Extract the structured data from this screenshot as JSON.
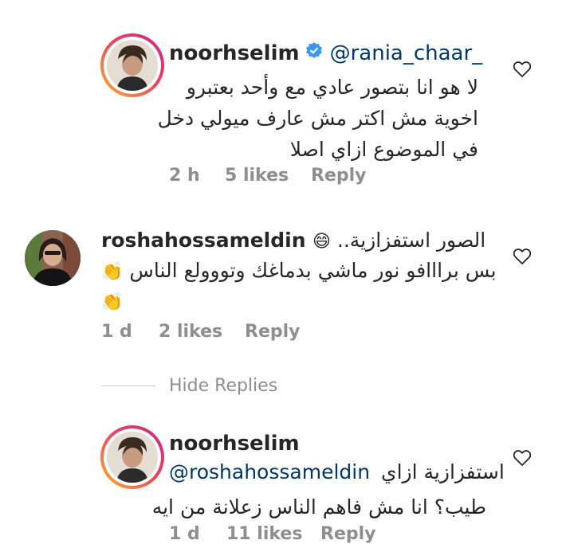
{
  "comments": [
    {
      "username": "noorhselim",
      "verified": true,
      "mention": "@rania_chaar_",
      "lines": [
        "لا هو انا بتصور عادي مع وأحد بعتبرو",
        "اخوية مش اكتر مش عارف ميولي دخل",
        "في الموضوع ازاي اصلا"
      ],
      "time": "2 h",
      "likes": "5 likes",
      "reply": "Reply"
    },
    {
      "username": "roshahossameldin",
      "line1_text": "الصور استفزازية..",
      "line1_emoji": "😄",
      "line2_text": "بس برااافو نور ماشي بدماغك وتووولع الناس",
      "line2_emoji": "👏",
      "line3_emoji": "👏",
      "time": "1 d",
      "likes": "2 likes",
      "reply": "Reply"
    }
  ],
  "hide_replies": "Hide Replies",
  "reply_comment": {
    "username": "noorhselim",
    "line1_text": "استفزازية ازاي",
    "mention": "@roshahossameldin",
    "line2": "طيب؟ انا مش فاهم الناس زعلانة من ايه",
    "time": "1 d",
    "likes": "11 likes",
    "reply": "Reply"
  },
  "colors": {
    "text": "#262626",
    "meta": "#8e8e8e",
    "mention": "#00376b",
    "verified": "#3897f0"
  },
  "icons": [
    "heart-outline-icon",
    "verified-badge-icon"
  ]
}
